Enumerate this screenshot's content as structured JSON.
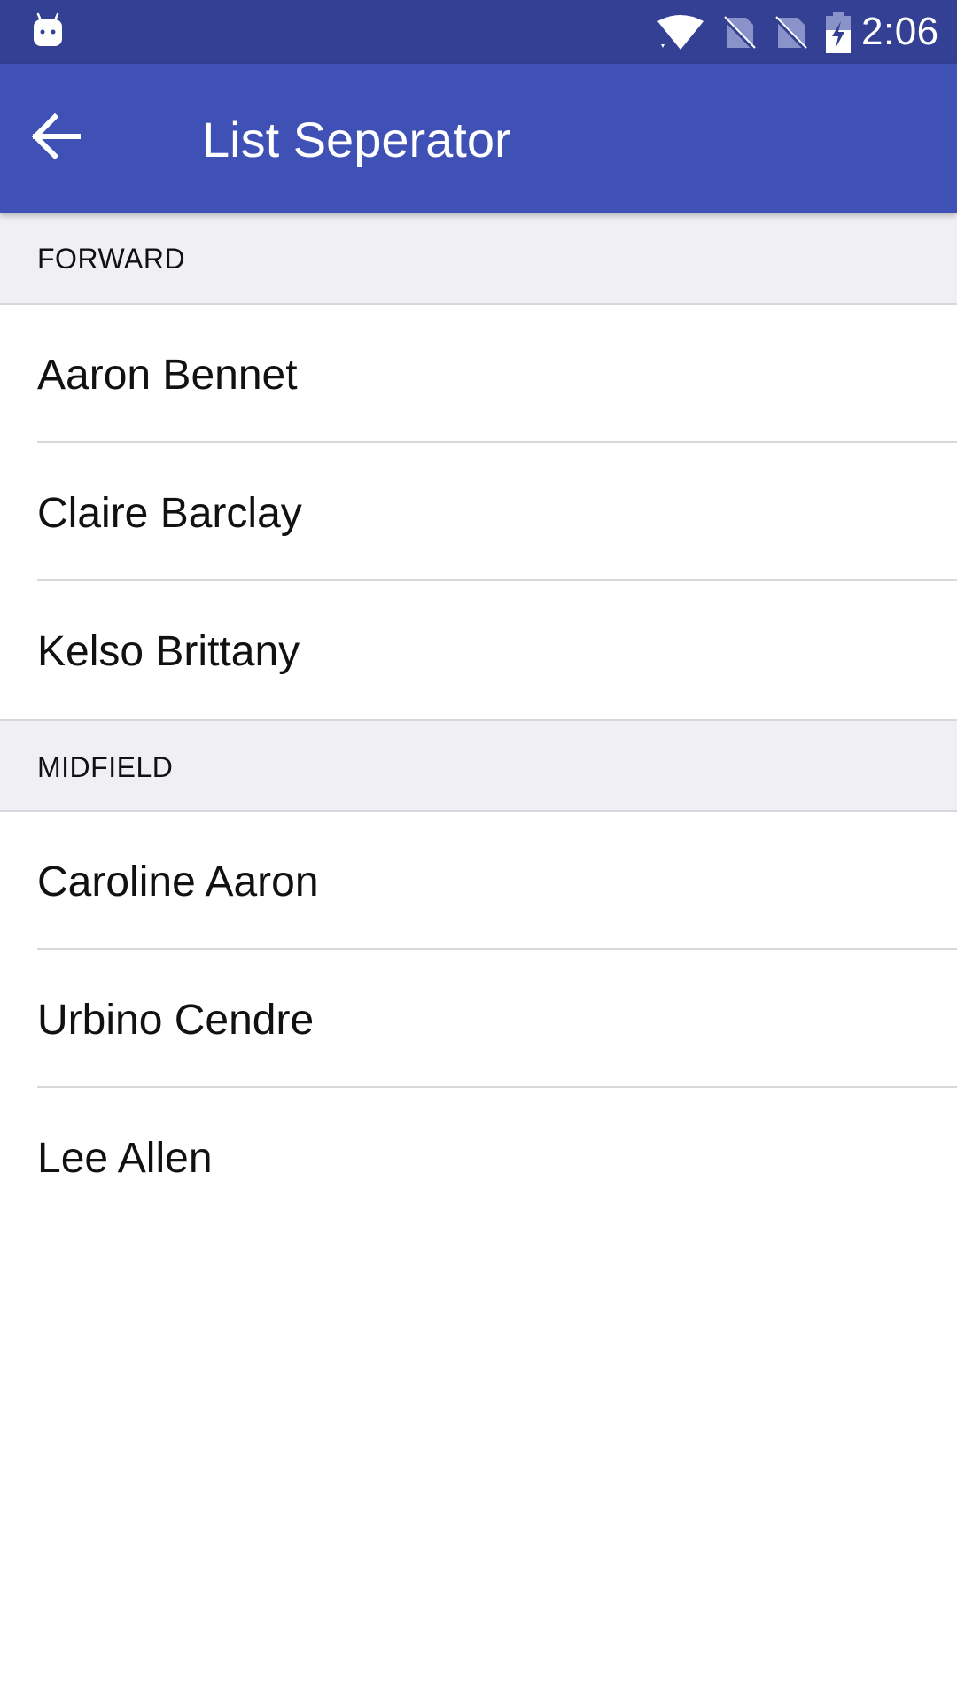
{
  "status_bar": {
    "time": "2:06",
    "icons": [
      "android-notification-icon",
      "wifi-icon",
      "no-sim-icon",
      "no-sim-icon",
      "battery-charging-icon"
    ]
  },
  "app_bar": {
    "title": "List Seperator",
    "back_icon": "arrow-back-icon",
    "color": "#3F51B5"
  },
  "sections": [
    {
      "header": "FORWARD",
      "items": [
        "Aaron Bennet",
        "Claire Barclay",
        "Kelso Brittany"
      ]
    },
    {
      "header": "MIDFIELD",
      "items": [
        "Caroline Aaron",
        "Urbino Cendre",
        "Lee Allen"
      ]
    }
  ],
  "colors": {
    "status_bar": "#334093",
    "section_background": "#EFEFF4",
    "divider": "#D8D8DC"
  }
}
